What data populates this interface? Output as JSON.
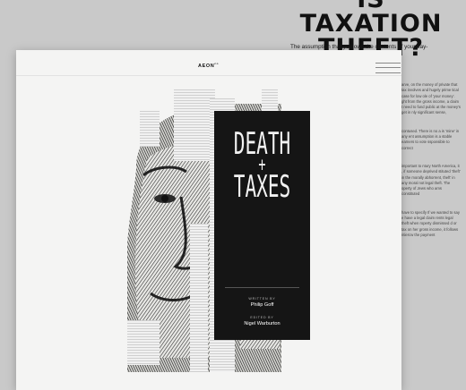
{
  "background_article": {
    "title_line1": "IS TAXATION",
    "title_line2": "THEFT?",
    "intro": "The assumption that you own the contents of your pay- monstrably",
    "column_paragraphs": [
      "arve, on the money of private that tax involves and hugely prime tical case for low ole of 'your money'. ght from the gross income, a claim t need to fund public at the money's get in nly significant sense,",
      "contused. There is no a is 'mine' in any ent assumption is a stable earners to vote ssponsible to correct",
      "important to ntury North America, it , if someone deprived stituted 'theft' in the morally abhorrent, theft' in any moral not legal theft. The operty of Jews who ams constituted",
      "have to specify If we wanted to say e have a legal claim rents legal theft when roperty dismissed d or tax on her gross income, it follows ntiercw the payment"
    ]
  },
  "card": {
    "logo": "AEON",
    "logo_sup": "co",
    "menu_icon": "hamburger-menu-icon",
    "panel": {
      "title_word1": "DEATH",
      "title_plus": "+",
      "title_word2": "TAXES",
      "written_by_label": "WRITTEN BY",
      "author": "Philip Goff",
      "edited_by_label": "EDITED BY",
      "editor": "Nigel Warburton"
    }
  },
  "colors": {
    "page_bg": "#c9c9c9",
    "card_bg": "#f4f4f3",
    "panel_bg": "#151515",
    "text_dark": "#111111"
  }
}
